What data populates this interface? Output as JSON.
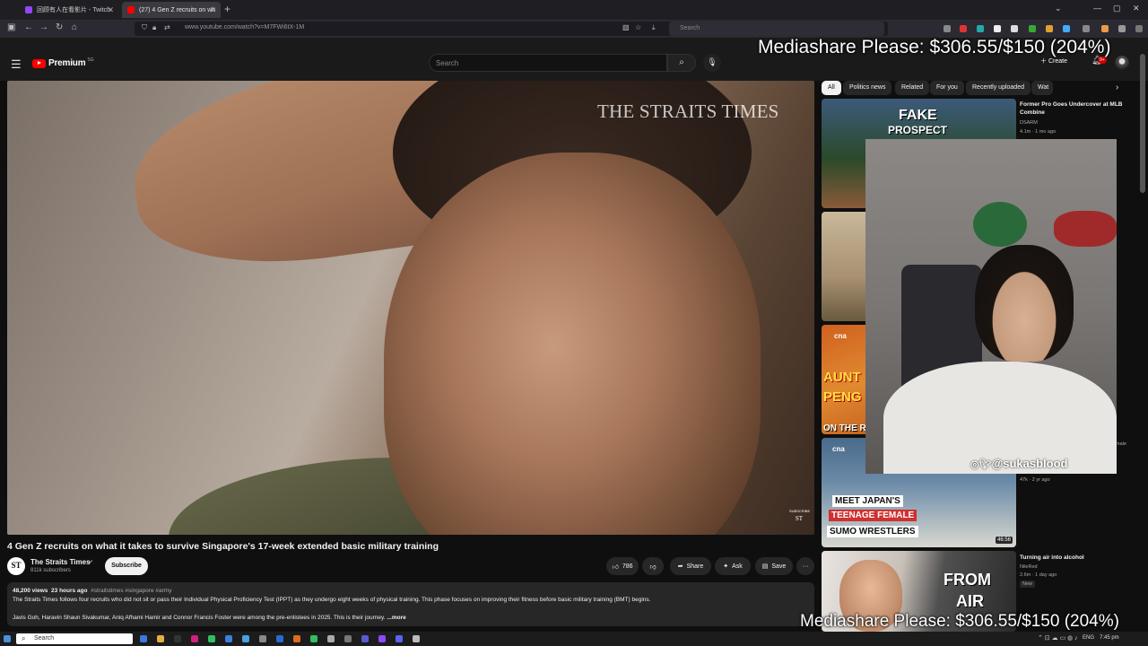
{
  "browser": {
    "tabs": [
      {
        "label": "回顾有人在看影片 - Twitch",
        "active": false
      },
      {
        "label": "(27) 4 Gen Z recruits on wh",
        "active": true
      }
    ],
    "new_tab": "+",
    "address": "www.youtube.com/watch?v=M7FWi6tX-1M",
    "search_placeholder": "Search"
  },
  "overlay": {
    "mediashare_top": "Mediashare Please: $306.55/$150 (204%)",
    "mediashare_bottom": "Mediashare Please: $306.55/$150 (204%)",
    "handle": "@sukasblood",
    "colors": {
      "text": "#ffffff"
    }
  },
  "youtube": {
    "logo_label": "Premium",
    "region": "SG",
    "search_placeholder": "Search",
    "create_label": "Create",
    "notification_badge": "9+",
    "brand_color": "#ff0000"
  },
  "video": {
    "watermark": "THE STRAITS TIMES",
    "corner_logo_top": "SUBSCRIBE",
    "corner_logo": "ST",
    "title": "4 Gen Z recruits on what it takes to survive Singapore's 17-week extended basic military training",
    "channel": {
      "name": "The Straits Times",
      "avatar_text": "ST",
      "subscribers": "811k subscribers",
      "subscribe_label": "Subscribe"
    },
    "actions": {
      "likes": "786",
      "share": "Share",
      "ask": "Ask",
      "save": "Save",
      "more": "···"
    },
    "description": {
      "views": "48,200 views",
      "age": "23 hours ago",
      "tags": "#straitstimes #singapore #army",
      "line1": "The Straits Times follows four recruits who did not sit or pass their Individual Physical Proficiency Test (IPPT) as they undergo eight weeks of physical training. This phase focuses on improving their fitness before basic military training (BMT) begins.",
      "line2": "Javis Goh, Haravin Shaun Sivakumar, Aniq Afhami Hamir and Connor Francis Foster were among the pre-enlistees in 2025. This is their journey.",
      "more": "...more"
    }
  },
  "sidebar": {
    "chips": [
      "All",
      "Politics news",
      "Related",
      "For you",
      "Recently uploaded",
      "Wat"
    ],
    "recs": [
      {
        "title": "Former Pro Goes Undercover at MLB Combine",
        "channel": "DSARM",
        "meta": "4.1m · 1 mo ago",
        "thumb_text1": "FAKE",
        "thumb_text2": "PROSPECT"
      },
      {
        "title": "",
        "channel": "",
        "meta": ""
      },
      {
        "title": "",
        "channel": "",
        "meta": "",
        "thumb_text1": "AUNT",
        "thumb_text2": "PENG",
        "thumb_text3": "ON THE RED",
        "badge": "cna"
      },
      {
        "title": "",
        "channel": "",
        "meta": "47k · 2 yr ago",
        "thumb_text1": "MEET JAPAN'S",
        "thumb_text2": "TEENAGE FEMALE",
        "thumb_text3": "SUMO WRESTLERS",
        "duration": "46:56",
        "badge": "cna"
      },
      {
        "title": "Turning air into alcohol",
        "channel": "NileRed",
        "meta": "2.6m · 1 day ago",
        "new_badge": "New",
        "thumb_text1": "FROM",
        "thumb_text2": "AIR"
      }
    ],
    "partial_labels": [
      "a",
      "male"
    ]
  },
  "taskbar": {
    "search": "Search",
    "lang": "ENG",
    "time": "7:45 pm"
  }
}
